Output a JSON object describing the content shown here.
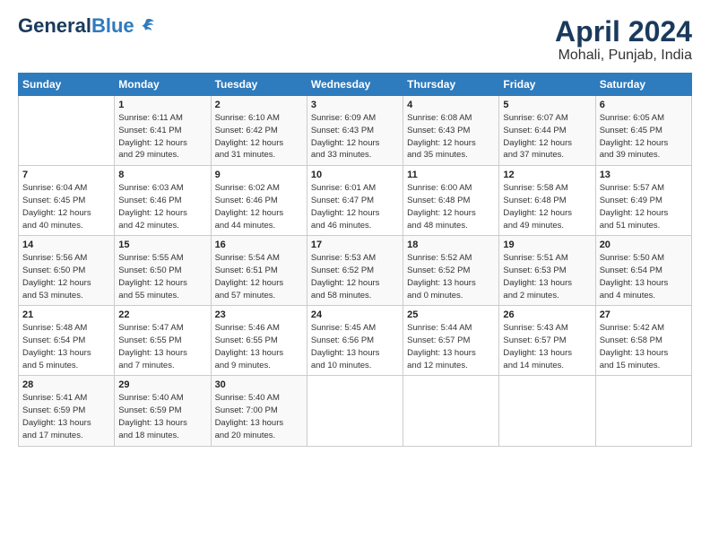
{
  "header": {
    "logo_general": "General",
    "logo_blue": "Blue",
    "month": "April 2024",
    "location": "Mohali, Punjab, India"
  },
  "weekdays": [
    "Sunday",
    "Monday",
    "Tuesday",
    "Wednesday",
    "Thursday",
    "Friday",
    "Saturday"
  ],
  "weeks": [
    [
      {
        "day": "",
        "info": ""
      },
      {
        "day": "1",
        "info": "Sunrise: 6:11 AM\nSunset: 6:41 PM\nDaylight: 12 hours\nand 29 minutes."
      },
      {
        "day": "2",
        "info": "Sunrise: 6:10 AM\nSunset: 6:42 PM\nDaylight: 12 hours\nand 31 minutes."
      },
      {
        "day": "3",
        "info": "Sunrise: 6:09 AM\nSunset: 6:43 PM\nDaylight: 12 hours\nand 33 minutes."
      },
      {
        "day": "4",
        "info": "Sunrise: 6:08 AM\nSunset: 6:43 PM\nDaylight: 12 hours\nand 35 minutes."
      },
      {
        "day": "5",
        "info": "Sunrise: 6:07 AM\nSunset: 6:44 PM\nDaylight: 12 hours\nand 37 minutes."
      },
      {
        "day": "6",
        "info": "Sunrise: 6:05 AM\nSunset: 6:45 PM\nDaylight: 12 hours\nand 39 minutes."
      }
    ],
    [
      {
        "day": "7",
        "info": "Sunrise: 6:04 AM\nSunset: 6:45 PM\nDaylight: 12 hours\nand 40 minutes."
      },
      {
        "day": "8",
        "info": "Sunrise: 6:03 AM\nSunset: 6:46 PM\nDaylight: 12 hours\nand 42 minutes."
      },
      {
        "day": "9",
        "info": "Sunrise: 6:02 AM\nSunset: 6:46 PM\nDaylight: 12 hours\nand 44 minutes."
      },
      {
        "day": "10",
        "info": "Sunrise: 6:01 AM\nSunset: 6:47 PM\nDaylight: 12 hours\nand 46 minutes."
      },
      {
        "day": "11",
        "info": "Sunrise: 6:00 AM\nSunset: 6:48 PM\nDaylight: 12 hours\nand 48 minutes."
      },
      {
        "day": "12",
        "info": "Sunrise: 5:58 AM\nSunset: 6:48 PM\nDaylight: 12 hours\nand 49 minutes."
      },
      {
        "day": "13",
        "info": "Sunrise: 5:57 AM\nSunset: 6:49 PM\nDaylight: 12 hours\nand 51 minutes."
      }
    ],
    [
      {
        "day": "14",
        "info": "Sunrise: 5:56 AM\nSunset: 6:50 PM\nDaylight: 12 hours\nand 53 minutes."
      },
      {
        "day": "15",
        "info": "Sunrise: 5:55 AM\nSunset: 6:50 PM\nDaylight: 12 hours\nand 55 minutes."
      },
      {
        "day": "16",
        "info": "Sunrise: 5:54 AM\nSunset: 6:51 PM\nDaylight: 12 hours\nand 57 minutes."
      },
      {
        "day": "17",
        "info": "Sunrise: 5:53 AM\nSunset: 6:52 PM\nDaylight: 12 hours\nand 58 minutes."
      },
      {
        "day": "18",
        "info": "Sunrise: 5:52 AM\nSunset: 6:52 PM\nDaylight: 13 hours\nand 0 minutes."
      },
      {
        "day": "19",
        "info": "Sunrise: 5:51 AM\nSunset: 6:53 PM\nDaylight: 13 hours\nand 2 minutes."
      },
      {
        "day": "20",
        "info": "Sunrise: 5:50 AM\nSunset: 6:54 PM\nDaylight: 13 hours\nand 4 minutes."
      }
    ],
    [
      {
        "day": "21",
        "info": "Sunrise: 5:48 AM\nSunset: 6:54 PM\nDaylight: 13 hours\nand 5 minutes."
      },
      {
        "day": "22",
        "info": "Sunrise: 5:47 AM\nSunset: 6:55 PM\nDaylight: 13 hours\nand 7 minutes."
      },
      {
        "day": "23",
        "info": "Sunrise: 5:46 AM\nSunset: 6:55 PM\nDaylight: 13 hours\nand 9 minutes."
      },
      {
        "day": "24",
        "info": "Sunrise: 5:45 AM\nSunset: 6:56 PM\nDaylight: 13 hours\nand 10 minutes."
      },
      {
        "day": "25",
        "info": "Sunrise: 5:44 AM\nSunset: 6:57 PM\nDaylight: 13 hours\nand 12 minutes."
      },
      {
        "day": "26",
        "info": "Sunrise: 5:43 AM\nSunset: 6:57 PM\nDaylight: 13 hours\nand 14 minutes."
      },
      {
        "day": "27",
        "info": "Sunrise: 5:42 AM\nSunset: 6:58 PM\nDaylight: 13 hours\nand 15 minutes."
      }
    ],
    [
      {
        "day": "28",
        "info": "Sunrise: 5:41 AM\nSunset: 6:59 PM\nDaylight: 13 hours\nand 17 minutes."
      },
      {
        "day": "29",
        "info": "Sunrise: 5:40 AM\nSunset: 6:59 PM\nDaylight: 13 hours\nand 18 minutes."
      },
      {
        "day": "30",
        "info": "Sunrise: 5:40 AM\nSunset: 7:00 PM\nDaylight: 13 hours\nand 20 minutes."
      },
      {
        "day": "",
        "info": ""
      },
      {
        "day": "",
        "info": ""
      },
      {
        "day": "",
        "info": ""
      },
      {
        "day": "",
        "info": ""
      }
    ]
  ]
}
